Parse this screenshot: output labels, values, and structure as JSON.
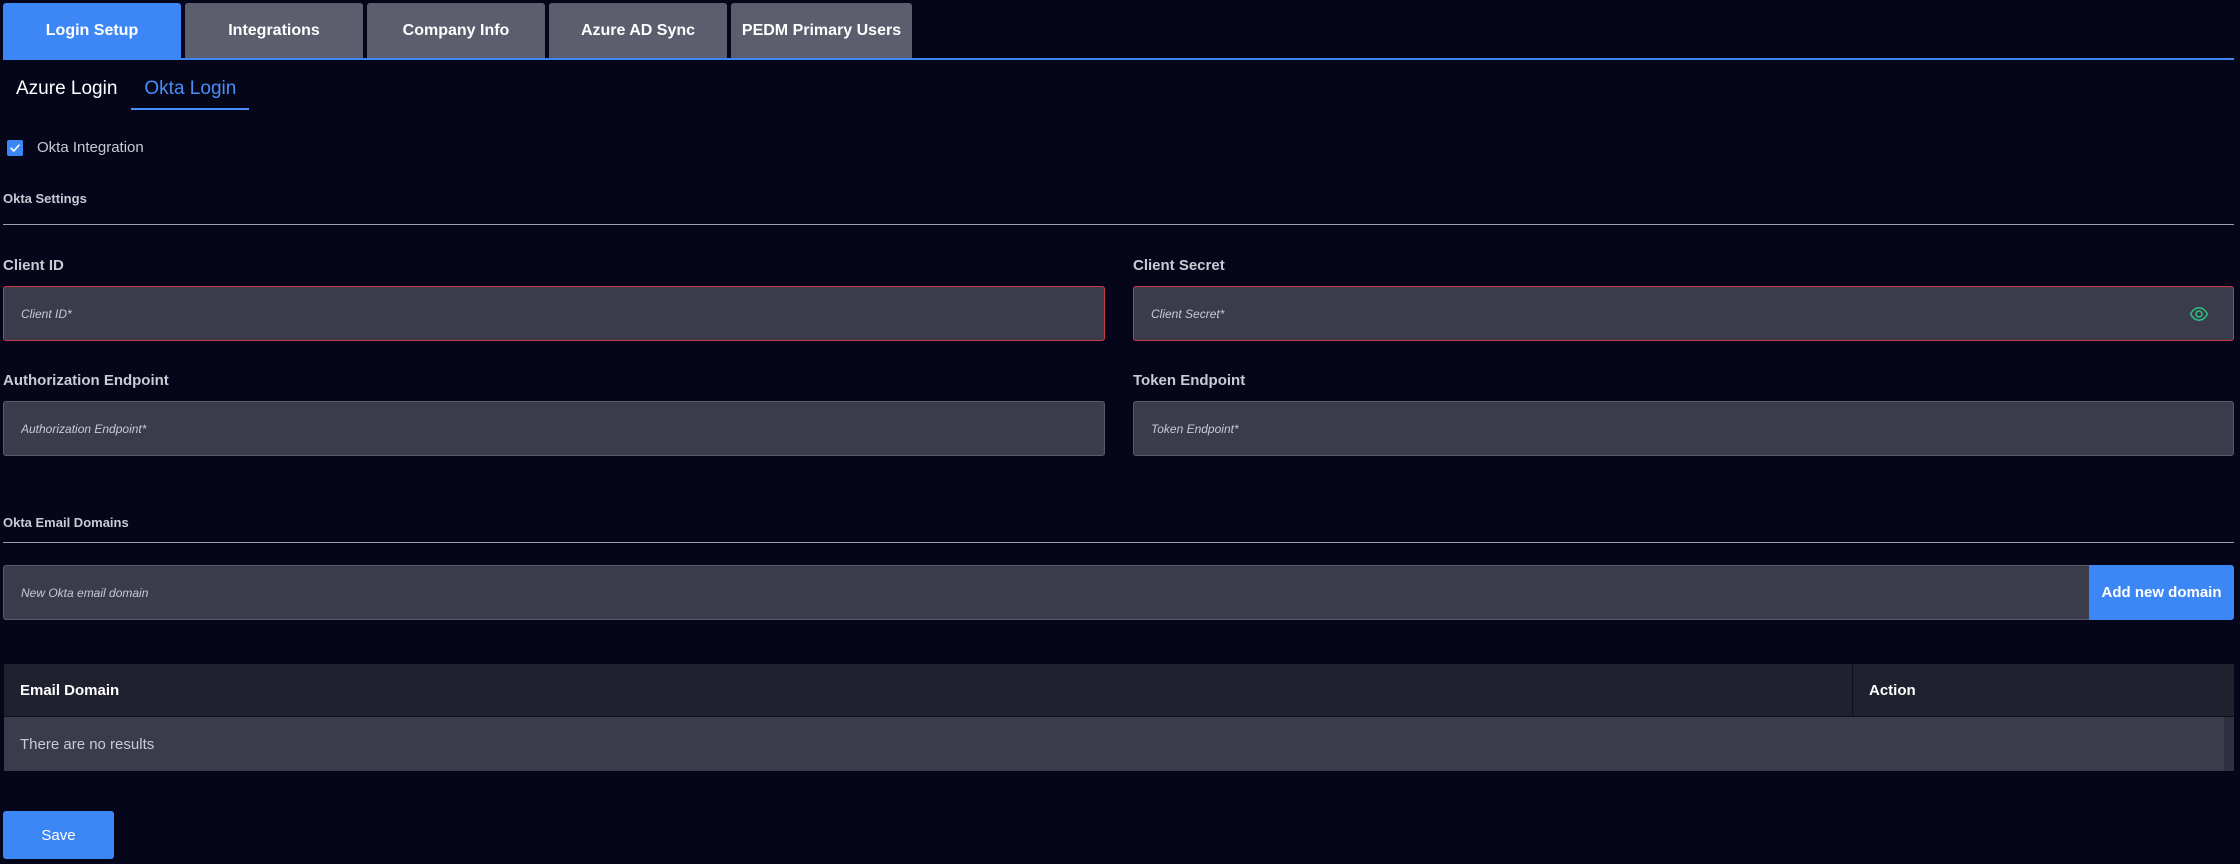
{
  "top_tabs": [
    {
      "label": "Login Setup",
      "active": true
    },
    {
      "label": "Integrations",
      "active": false
    },
    {
      "label": "Company Info",
      "active": false
    },
    {
      "label": "Azure AD Sync",
      "active": false
    },
    {
      "label": "PEDM Primary Users",
      "active": false
    }
  ],
  "sub_tabs": [
    {
      "label": "Azure Login",
      "active": false
    },
    {
      "label": "Okta Login",
      "active": true
    }
  ],
  "okta_integration": {
    "label": "Okta Integration",
    "checked": true
  },
  "okta_settings": {
    "title": "Okta Settings",
    "client_id": {
      "label": "Client ID",
      "placeholder": "Client ID*",
      "value": ""
    },
    "client_secret": {
      "label": "Client Secret",
      "placeholder": "Client Secret*",
      "value": ""
    },
    "authorization_endpoint": {
      "label": "Authorization Endpoint",
      "placeholder": "Authorization Endpoint*",
      "value": ""
    },
    "token_endpoint": {
      "label": "Token Endpoint",
      "placeholder": "Token Endpoint*",
      "value": ""
    }
  },
  "email_domains": {
    "title": "Okta Email Domains",
    "input_placeholder": "New Okta email domain",
    "add_button": "Add new domain",
    "table": {
      "columns": [
        "Email Domain",
        "Action"
      ],
      "empty_text": "There are no results"
    }
  },
  "save_label": "Save",
  "colors": {
    "background": "#05061a",
    "accent": "#3d86f5",
    "error_border": "#c73b49",
    "eye_icon": "#2ec27e"
  }
}
